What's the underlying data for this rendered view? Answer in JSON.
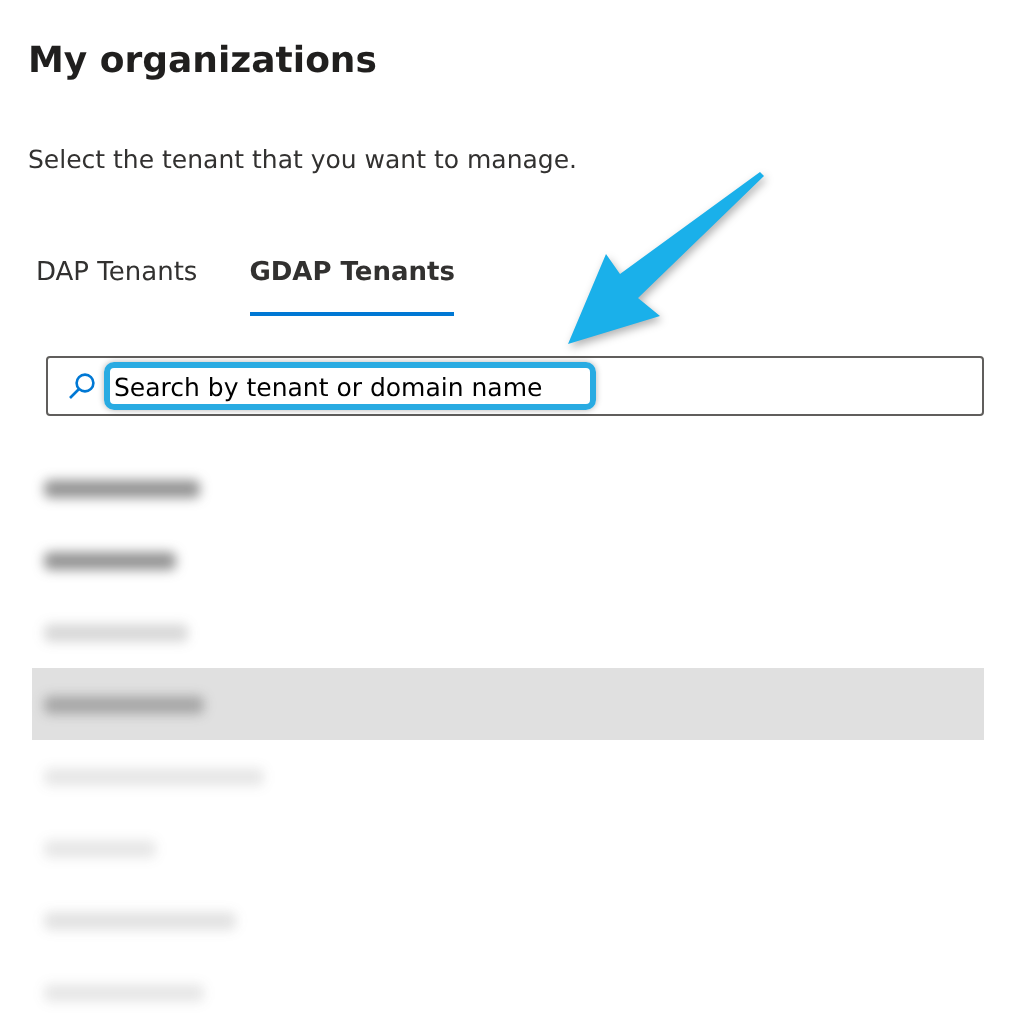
{
  "page": {
    "title": "My organizations",
    "subtitle": "Select the tenant that you want to manage."
  },
  "tabs": [
    {
      "label": "DAP Tenants",
      "selected": false
    },
    {
      "label": "GDAP Tenants",
      "selected": true
    }
  ],
  "search": {
    "placeholder": "Search by tenant or domain name"
  },
  "tenants": [
    {
      "selected": false
    },
    {
      "selected": false
    },
    {
      "selected": false
    },
    {
      "selected": true
    },
    {
      "selected": false
    },
    {
      "selected": false
    },
    {
      "selected": false
    },
    {
      "selected": false
    }
  ]
}
